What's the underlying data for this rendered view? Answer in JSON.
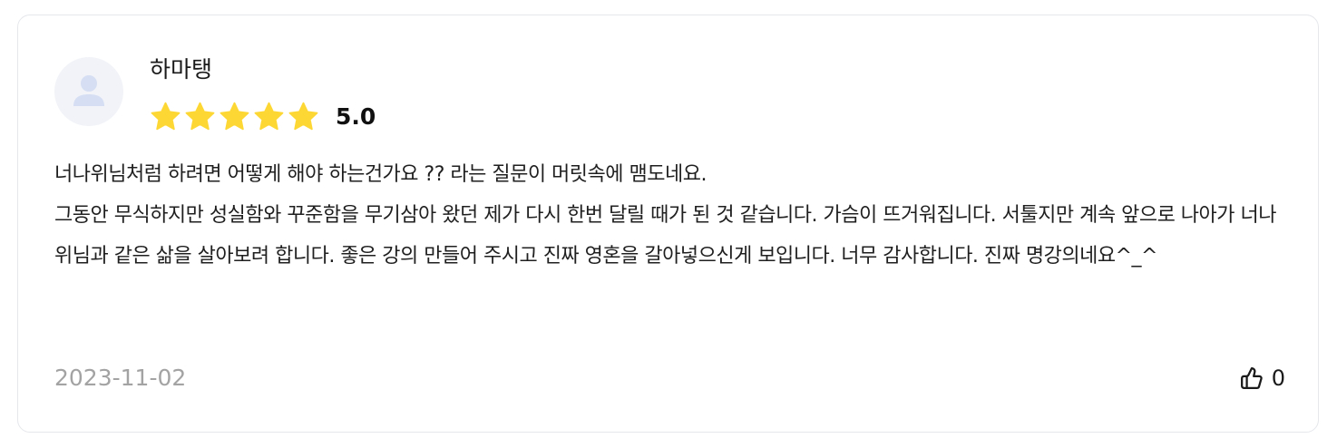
{
  "review": {
    "author": "하마탱",
    "rating": 5,
    "rating_label": "5.0",
    "body_lines": [
      "너나위님처럼 하려면 어떻게 해야 하는건가요 ?? 라는 질문이 머릿속에 맴도네요.",
      "그동안 무식하지만 성실함와 꾸준함을 무기삼아 왔던 제가 다시 한번 달릴 때가 된 것 같습니다. 가슴이 뜨거워집니다. 서툴지만 계속 앞으로 나아가 너나위님과 같은 삶을 살아보려 합니다. 좋은 강의 만들어 주시고 진짜 영혼을 갈아넣으신게 보입니다. 너무 감사합니다. 진짜 명강의네요^_^"
    ],
    "date": "2023-11-02",
    "like_count": "0"
  },
  "icons": {
    "avatar": "user-silhouette-icon",
    "star": "star-filled-icon",
    "like": "thumbs-up-icon"
  },
  "colors": {
    "star": "#FDD835",
    "avatar_bg": "#F1F3F8",
    "avatar_figure": "#D5DEF3",
    "date_text": "#A3A3A3",
    "border": "#E5E7EB"
  }
}
